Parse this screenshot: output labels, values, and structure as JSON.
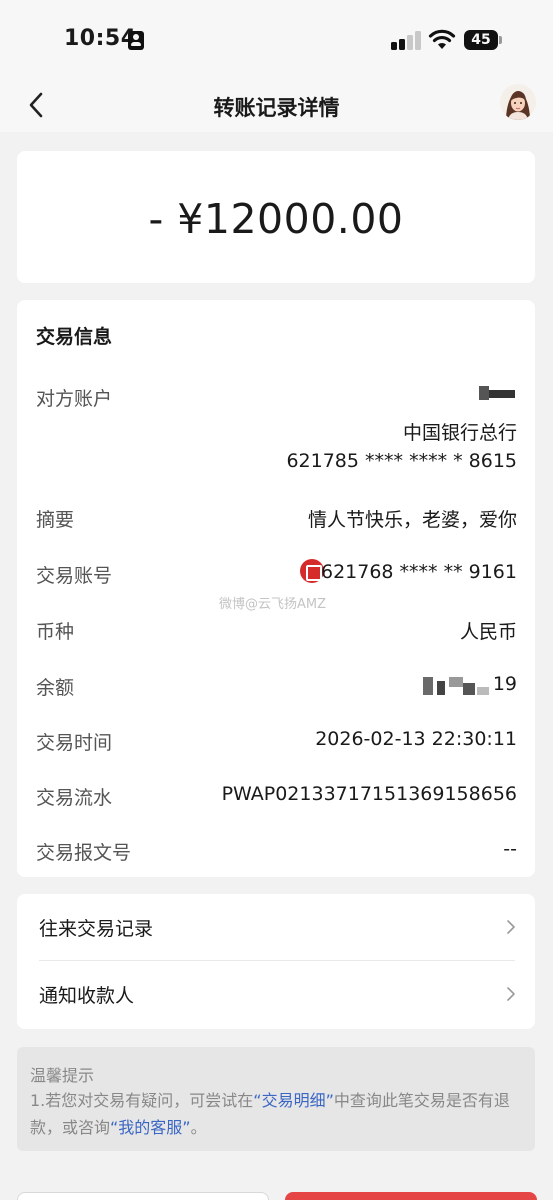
{
  "status_bar": {
    "time": "10:54",
    "battery": "45",
    "icons": [
      "signal-icon",
      "wifi-icon",
      "battery-icon"
    ]
  },
  "nav": {
    "title": "转账记录详情",
    "back_icon": "chevron-left-icon"
  },
  "amount": "- ¥12000.00",
  "info": {
    "section_title": "交易信息",
    "counterparty": {
      "label": "对方账户",
      "bank": "中国银行总行",
      "account": "621785 **** **** * 8615"
    },
    "memo": {
      "label": "摘要",
      "value": "情人节快乐，老婆，爱你"
    },
    "account": {
      "label": "交易账号",
      "value": "621768 **** ** 9161"
    },
    "currency": {
      "label": "币种",
      "value": "人民币"
    },
    "balance": {
      "label": "余额",
      "value": "19"
    },
    "time": {
      "label": "交易时间",
      "value": "2026-02-13 22:30:11"
    },
    "serial": {
      "label": "交易流水",
      "value": "PWAP02133717151369158656"
    },
    "message_no": {
      "label": "交易报文号",
      "value": "--"
    }
  },
  "watermark": "微博@云飞扬AMZ",
  "links": [
    {
      "label": "往来交易记录"
    },
    {
      "label": "通知收款人"
    }
  ],
  "tip": {
    "title": "温馨提示",
    "text_before": "1.若您对交易有疑问，可尝试在",
    "link1": "“交易明细”",
    "text_middle": "中查询此笔交易是否有退款，或咨询",
    "link2": "“我的客服”",
    "text_after": "。"
  },
  "colors": {
    "background": "#f2f2f2",
    "card": "#ffffff",
    "link": "#3a66c4",
    "bank_logo": "#d62b2b"
  }
}
